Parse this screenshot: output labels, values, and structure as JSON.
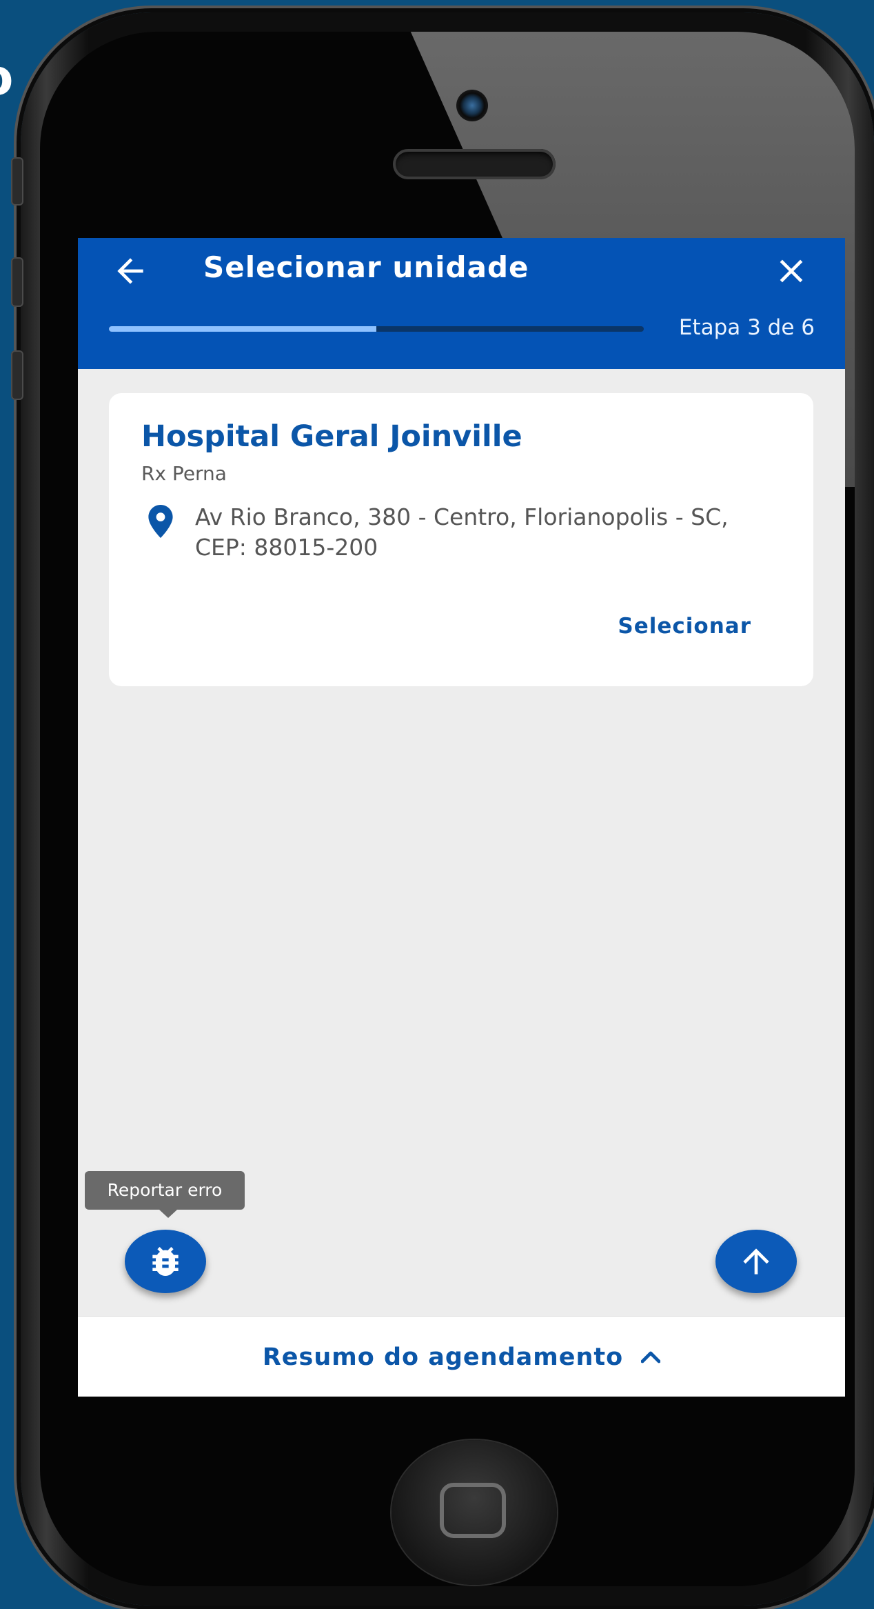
{
  "background_fragment": "o",
  "appbar": {
    "title": "Selecionar unidade",
    "step_label": "Etapa 3 de 6",
    "progress_fraction": 0.5,
    "back_icon": "arrow-left-icon",
    "close_icon": "close-icon"
  },
  "card": {
    "title": "Hospital Geral Joinville",
    "subtitle": "Rx Perna",
    "address": "Av Rio Branco, 380 - Centro, Florianopolis - SC, CEP: 88015-200",
    "location_icon": "map-pin-icon",
    "select_label": "Selecionar"
  },
  "tooltip": {
    "text": "Reportar erro"
  },
  "fabs": {
    "bug_icon": "bug-icon",
    "up_icon": "arrow-up-icon"
  },
  "summary": {
    "label": "Resumo do agendamento",
    "icon": "chevron-up-icon"
  },
  "colors": {
    "primary": "#0453b5",
    "accent_text": "#0b56a8",
    "page_bg": "#0a4f7e",
    "screen_bg": "#ededed"
  }
}
